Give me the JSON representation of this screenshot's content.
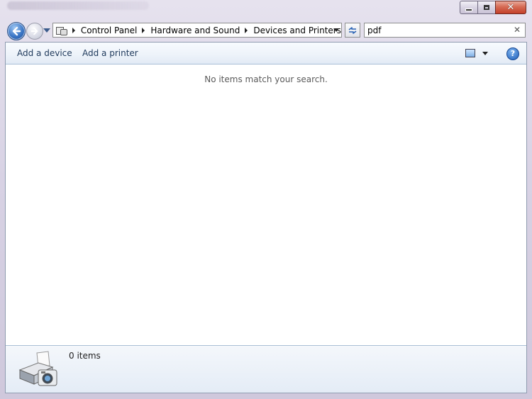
{
  "window": {
    "caption_minimize": "minimize",
    "caption_maximize": "maximize",
    "caption_close": "close"
  },
  "navigation": {
    "breadcrumbs": [
      "Control Panel",
      "Hardware and Sound",
      "Devices and Printers"
    ],
    "search_value": "pdf"
  },
  "toolbar": {
    "add_device": "Add a device",
    "add_printer": "Add a printer",
    "help": "?"
  },
  "content": {
    "empty_message": "No items match your search."
  },
  "details_pane": {
    "count": "0 items"
  },
  "icons": {
    "back": "back-arrow-icon",
    "forward": "forward-arrow-icon",
    "refresh": "refresh-icon",
    "clear": "clear-search-icon",
    "views": "change-view-icon",
    "help": "help-icon",
    "devices": "printer-camera-icon"
  },
  "colors": {
    "link_text": "#1e395b",
    "close_button": "#c4402a",
    "toolbar_bg": "#eef3fa"
  }
}
